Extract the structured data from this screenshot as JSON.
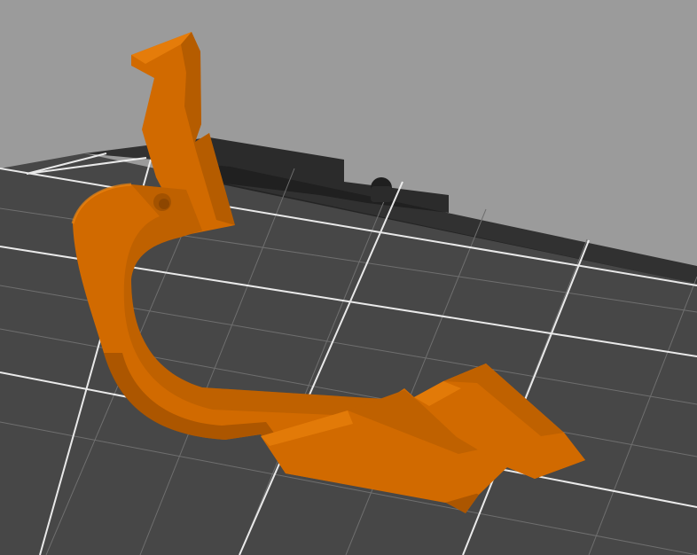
{
  "viewport": {
    "background_color": "#9b9b9b"
  },
  "build_plate": {
    "surface_color": "#474747",
    "grid_minor_color": "#6f6f6f",
    "grid_major_color": "#f2f2f2",
    "border_color": "#1f1f1f",
    "logo_color": "#2b2b2b"
  },
  "model": {
    "color": "#d16a00",
    "shadow_color": "#9f5000",
    "highlight_color": "#f0860f",
    "hole_color": "#a35200"
  }
}
